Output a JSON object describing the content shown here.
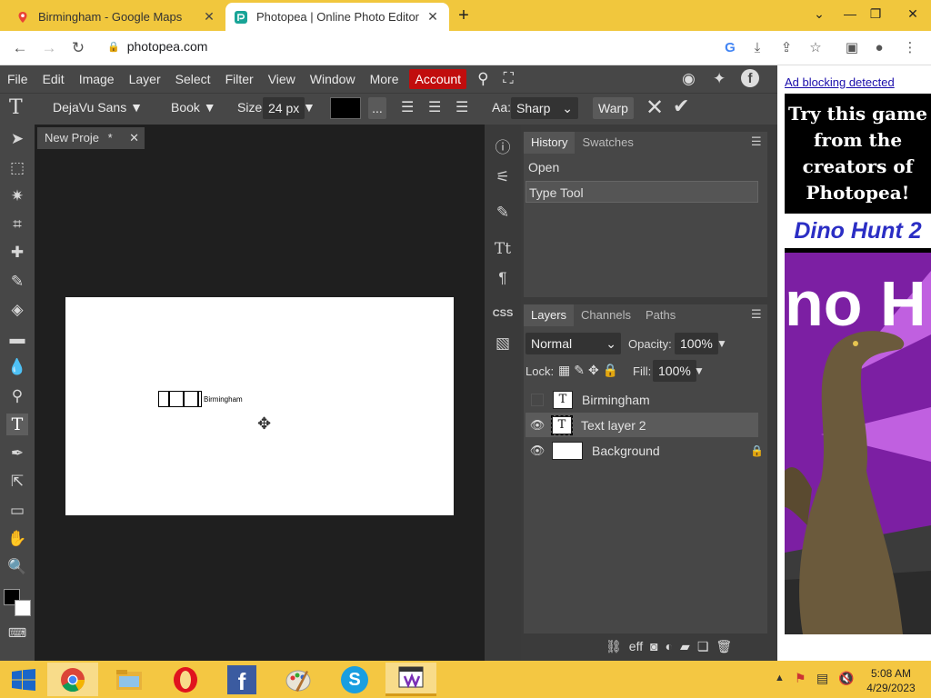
{
  "browser": {
    "tabs": [
      {
        "title": "Birmingham - Google Maps"
      },
      {
        "title": "Photopea | Online Photo Editor"
      }
    ],
    "url": "photopea.com"
  },
  "menubar": [
    "File",
    "Edit",
    "Image",
    "Layer",
    "Select",
    "Filter",
    "View",
    "Window",
    "More"
  ],
  "account_label": "Account",
  "options": {
    "font_family": "DejaVu Sans",
    "font_style": "Book",
    "size_label": "Size:",
    "size_value": "24 px",
    "more_label": "...",
    "aa_label": "Aa:",
    "aa_value": "Sharp",
    "warp_label": "Warp"
  },
  "document": {
    "tab_title": "New Proje",
    "tab_modified": "*",
    "canvas_text": "Birmingham"
  },
  "history": {
    "tabs": [
      "History",
      "Swatches"
    ],
    "items": [
      "Open",
      "Type Tool"
    ]
  },
  "layers": {
    "tabs": [
      "Layers",
      "Channels",
      "Paths"
    ],
    "blend_mode": "Normal",
    "opacity_label": "Opacity:",
    "opacity_value": "100%",
    "lock_label": "Lock:",
    "fill_label": "Fill:",
    "fill_value": "100%",
    "items": [
      {
        "name": "Birmingham",
        "thumb": "T"
      },
      {
        "name": "Text layer 2",
        "thumb": "T"
      },
      {
        "name": "Background",
        "thumb": ""
      }
    ],
    "footer_eff": "eff"
  },
  "side_icons": {
    "css_label": "CSS"
  },
  "ad": {
    "link_text": "Ad blocking detected",
    "headline": "Try this game from the creators of Photopea!",
    "game_title": "Dino Hunt 2"
  },
  "taskbar": {
    "time": "5:08 AM",
    "date": "4/29/2023"
  },
  "colors": {
    "tabstrip": "#f1c73d",
    "menubar": "#474747",
    "account": "#c10d0d",
    "taskbar": "#f4c742"
  }
}
